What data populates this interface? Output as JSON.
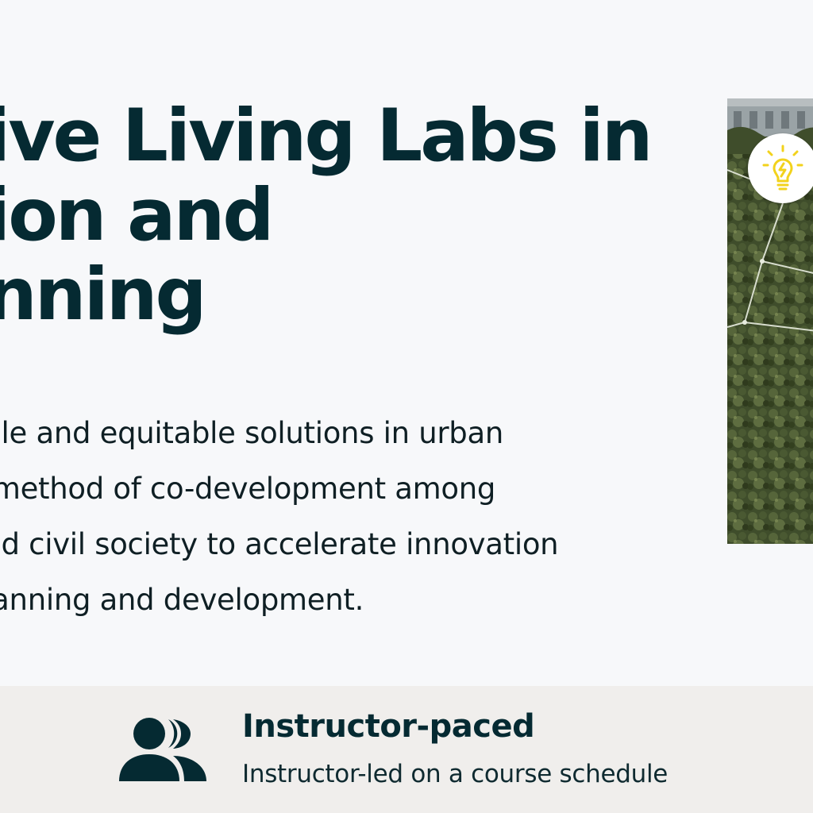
{
  "hero": {
    "title_lines": [
      "ive Living Labs in",
      "ion and",
      "nning"
    ],
    "description_lines": [
      "able and equitable solutions in urban",
      "a method of co-development among",
      "and civil society to accelerate innovation",
      "planning and development."
    ],
    "image_icon": "lightbulb-icon",
    "badge_color": "#f2d21c"
  },
  "course_info": {
    "pace_icon": "users-icon",
    "pace_title": "Instructor-paced",
    "pace_description": "Instructor-led on a course schedule"
  },
  "colors": {
    "heading": "#052a32",
    "background": "#f7f8fa",
    "info_bar": "#f0eeec"
  }
}
